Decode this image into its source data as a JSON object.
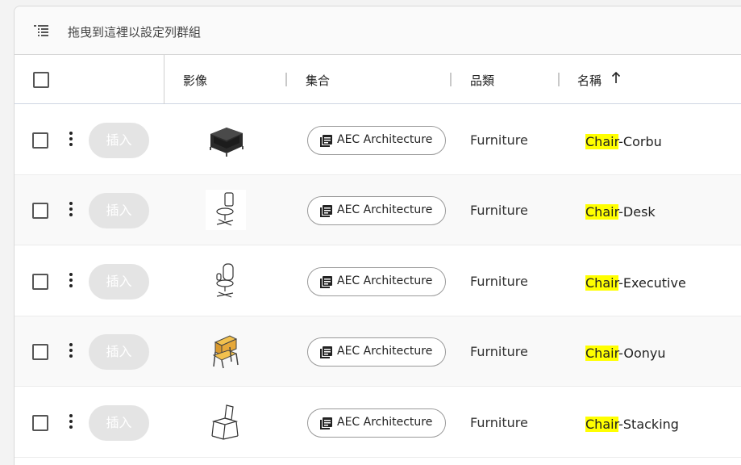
{
  "group_bar": {
    "placeholder": "拖曳到這裡以設定列群組",
    "icon": "group-rows-icon"
  },
  "header": {
    "columns": [
      {
        "label": "影像"
      },
      {
        "label": "集合"
      },
      {
        "label": "品類"
      },
      {
        "label": "名稱",
        "sort": "ascending"
      }
    ]
  },
  "rows": [
    {
      "insert_label": "插入",
      "thumbnail": "chair-corbu-thumbnail",
      "collection": "AEC Architecture",
      "category": "Furniture",
      "name_highlight": "Chair",
      "name_rest": "-Corbu"
    },
    {
      "insert_label": "插入",
      "thumbnail": "chair-desk-thumbnail",
      "collection": "AEC Architecture",
      "category": "Furniture",
      "name_highlight": "Chair",
      "name_rest": "-Desk"
    },
    {
      "insert_label": "插入",
      "thumbnail": "chair-executive-thumbnail",
      "collection": "AEC Architecture",
      "category": "Furniture",
      "name_highlight": "Chair",
      "name_rest": "-Executive"
    },
    {
      "insert_label": "插入",
      "thumbnail": "chair-oonyu-thumbnail",
      "collection": "AEC Architecture",
      "category": "Furniture",
      "name_highlight": "Chair",
      "name_rest": "-Oonyu"
    },
    {
      "insert_label": "插入",
      "thumbnail": "chair-stacking-thumbnail",
      "collection": "AEC Architecture",
      "category": "Furniture",
      "name_highlight": "Chair",
      "name_rest": "-Stacking"
    }
  ],
  "colors": {
    "highlight": "#ffff00",
    "insert_disabled": "#e4e4e4"
  }
}
